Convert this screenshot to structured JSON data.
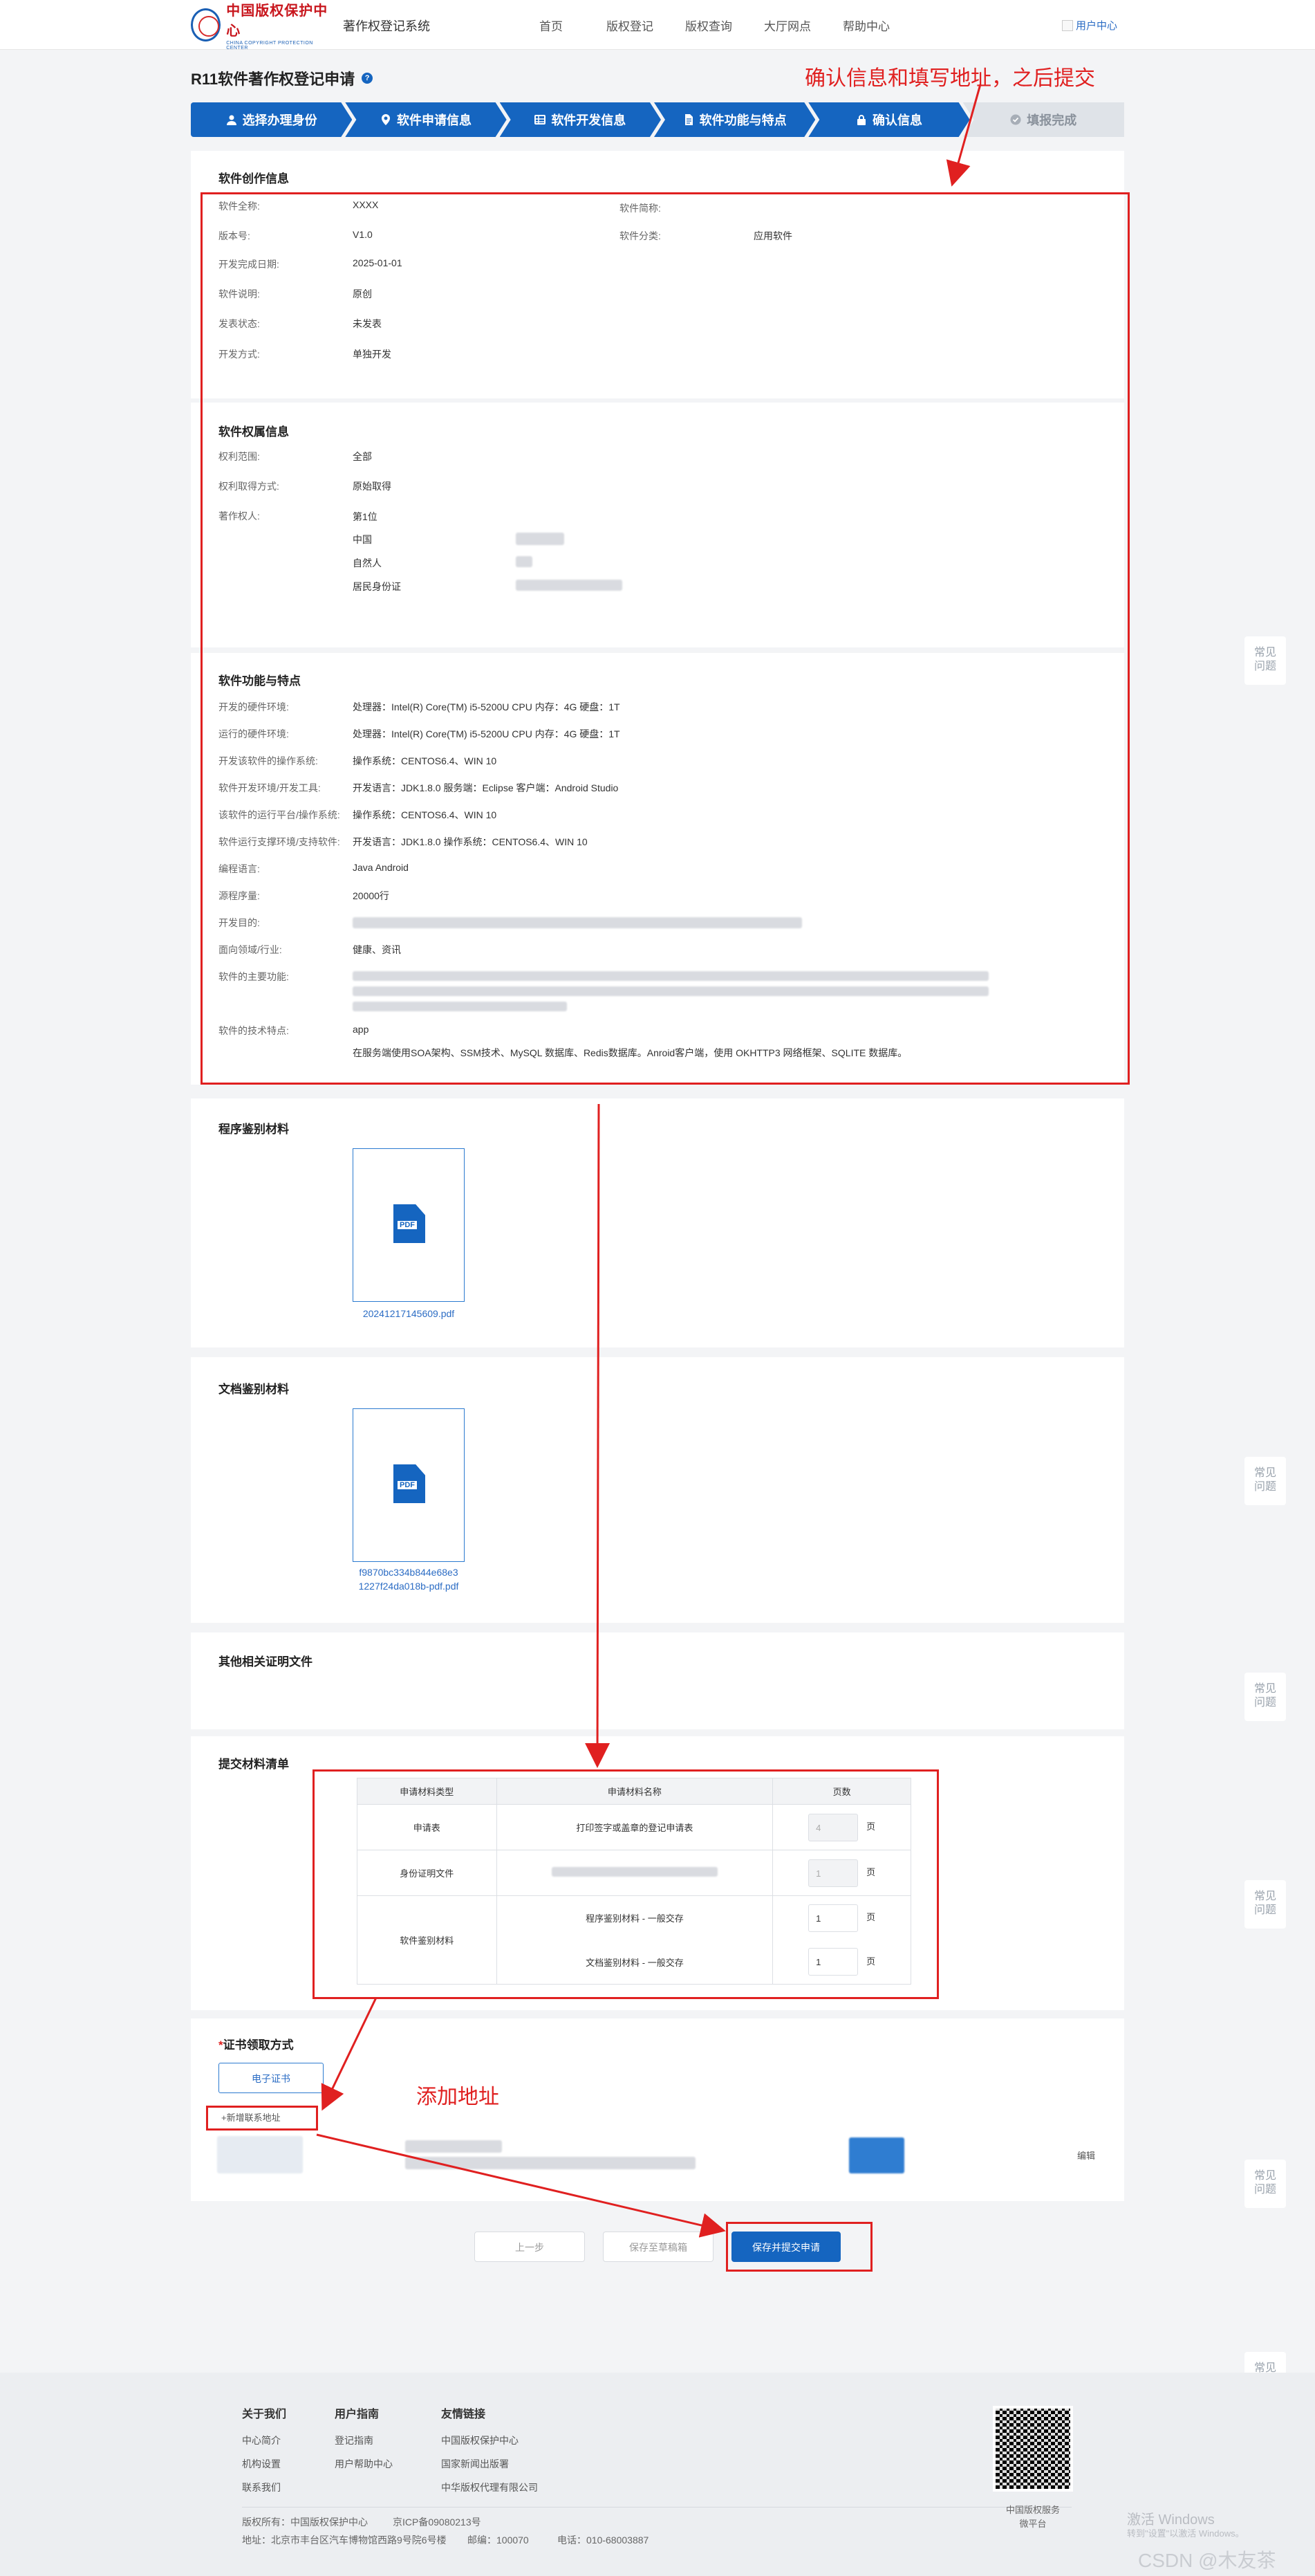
{
  "header": {
    "logo_cn": "中国版权保护中心",
    "logo_en": "CHINA COPYRIGHT PROTECTION CENTER",
    "system_name": "著作权登记系统",
    "nav": [
      "首页",
      "版权登记",
      "版权查询",
      "大厅网点",
      "帮助中心"
    ],
    "user_center": "用户中心"
  },
  "page": {
    "title": "R11软件著作权登记申请",
    "help_icon": "?"
  },
  "steps": [
    "选择办理身份",
    "软件申请信息",
    "软件开发信息",
    "软件功能与特点",
    "确认信息",
    "填报完成"
  ],
  "annotations": {
    "top": "确认信息和填写地址，之后提交",
    "address": "添加地址"
  },
  "work_info": {
    "title": "软件创作信息",
    "full_name_label": "软件全称:",
    "full_name": "XXXX",
    "short_name_label": "软件简称:",
    "version_label": "版本号:",
    "version": "V1.0",
    "category_label": "软件分类:",
    "category": "应用软件",
    "finish_date_label": "开发完成日期:",
    "finish_date": "2025-01-01",
    "desc_label": "软件说明:",
    "desc": "原创",
    "publish_label": "发表状态:",
    "publish": "未发表",
    "dev_mode_label": "开发方式:",
    "dev_mode": "单独开发"
  },
  "rights_info": {
    "title": "软件权属信息",
    "scope_label": "权利范围:",
    "scope": "全部",
    "obtain_label": "权利取得方式:",
    "obtain": "原始取得",
    "owner_label": "著作权人:",
    "owner_rank": "第1位",
    "country": "中国",
    "owner_type": "自然人",
    "id_type": "居民身份证"
  },
  "features": {
    "title": "软件功能与特点",
    "rows": [
      {
        "label": "开发的硬件环境:",
        "value": "处理器：Intel(R) Core(TM) i5-5200U CPU 内存：4G 硬盘：1T"
      },
      {
        "label": "运行的硬件环境:",
        "value": "处理器：Intel(R) Core(TM) i5-5200U CPU 内存：4G 硬盘：1T"
      },
      {
        "label": "开发该软件的操作系统:",
        "value": "操作系统：CENTOS6.4、WIN 10"
      },
      {
        "label": "软件开发环境/开发工具:",
        "value": "开发语言：JDK1.8.0 服务端：Eclipse 客户端：Android Studio"
      },
      {
        "label": "该软件的运行平台/操作系统:",
        "value": "操作系统：CENTOS6.4、WIN 10"
      },
      {
        "label": "软件运行支撑环境/支持软件:",
        "value": "开发语言：JDK1.8.0 操作系统：CENTOS6.4、WIN 10"
      },
      {
        "label": "编程语言:",
        "value": "Java  Android"
      },
      {
        "label": "源程序量:",
        "value": "20000行"
      },
      {
        "label": "开发目的:",
        "value": ""
      },
      {
        "label": "面向领域/行业:",
        "value": "健康、资讯"
      },
      {
        "label": "软件的主要功能:",
        "value": ""
      },
      {
        "label": "软件的技术特点:",
        "value": "app"
      }
    ],
    "tech_detail": "在服务端使用SOA架构、SSM技术、MySQL 数据库、Redis数据库。Anroid客户端，使用 OKHTTP3 网络框架、SQLITE 数据库。"
  },
  "program_material": {
    "title": "程序鉴别材料",
    "file_type": "PDF",
    "file_name": "20241217145609.pdf"
  },
  "doc_material": {
    "title": "文档鉴别材料",
    "file_type": "PDF",
    "file_name_line1": "f9870bc334b844e68e3",
    "file_name_line2": "1227f24da018b-pdf.pdf"
  },
  "other_docs": {
    "title": "其他相关证明文件"
  },
  "submit_list": {
    "title": "提交材料清单",
    "headers": [
      "申请材料类型",
      "申请材料名称",
      "页数"
    ],
    "row1": {
      "type": "申请表",
      "name": "打印签字或盖章的登记申请表",
      "pages": "4",
      "unit": "页"
    },
    "row2": {
      "type": "身份证明文件",
      "pages": "1",
      "unit": "页"
    },
    "row3": {
      "type": "软件鉴别材料",
      "name_a": "程序鉴别材料 - 一般交存",
      "pages_a": "1",
      "name_b": "文档鉴别材料 - 一般交存",
      "pages_b": "1",
      "unit": "页"
    }
  },
  "cert": {
    "required_mark": "*",
    "title": "证书领取方式",
    "option": "电子证书",
    "add_address": "+新增联系地址",
    "edit": "编辑"
  },
  "buttons": {
    "prev": "上一步",
    "save_draft": "保存至草稿箱",
    "submit": "保存并提交申请"
  },
  "footer": {
    "about_title": "关于我们",
    "about_items": [
      "中心简介",
      "机构设置",
      "联系我们"
    ],
    "guide_title": "用户指南",
    "guide_items": [
      "登记指南",
      "用户帮助中心"
    ],
    "links_title": "友情链接",
    "links_items": [
      "中国版权保护中心",
      "国家新闻出版署",
      "中华版权代理有限公司"
    ],
    "copyright": "版权所有：中国版权保护中心",
    "icp": "京ICP备09080213号",
    "address": "地址：北京市丰台区汽车博物馆西路9号院6号楼",
    "postcode": "邮编：100070",
    "phone": "电话：010-68003887",
    "qr_caption_1": "中国版权服务",
    "qr_caption_2": "微平台"
  },
  "side_widget": "常见\n问题",
  "os_watermark": {
    "line1": "激活 Windows",
    "line2": "转到\"设置\"以激活 Windows。",
    "csdn": "CSDN @木友茶"
  },
  "colors": {
    "primary": "#1565c0",
    "annotation_red": "#e02020",
    "step_done": "#dfe3e8"
  }
}
